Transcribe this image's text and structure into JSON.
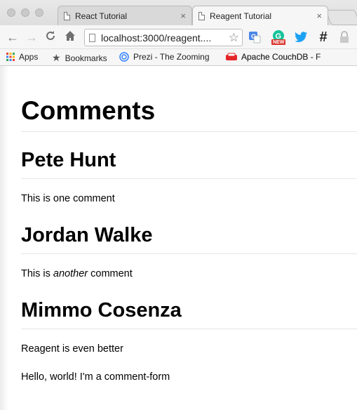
{
  "browser": {
    "tabs": [
      {
        "title": "React Tutorial",
        "active": false
      },
      {
        "title": "Reagent Tutorial",
        "active": true
      }
    ],
    "tab_close_glyph": "×",
    "url": "localhost:3000/reagent....",
    "bookmarks": [
      {
        "label": "Apps",
        "icon": "apps-grid-icon"
      },
      {
        "label": "Bookmarks",
        "icon": "star-icon"
      },
      {
        "label": "Prezi - The Zooming",
        "icon": "prezi-icon"
      },
      {
        "label": "Apache CouchDB - F",
        "icon": "couchdb-icon"
      }
    ],
    "extension_badge": "NEW",
    "extension_hash": "#"
  },
  "page": {
    "title": "Comments",
    "comments": [
      {
        "author": "Pete Hunt",
        "text_before": "This is one comment",
        "emphasis": "",
        "text_after": ""
      },
      {
        "author": "Jordan Walke",
        "text_before": "This is ",
        "emphasis": "another",
        "text_after": " comment"
      },
      {
        "author": "Mimmo Cosenza",
        "text_before": "Reagent is even better",
        "emphasis": "",
        "text_after": ""
      }
    ],
    "form_text": "Hello, world! I'm a comment-form"
  },
  "colors": {
    "twitter_blue": "#1da1f2",
    "grammarly_green": "#15c39a",
    "badge_red": "#d9342b",
    "couchdb_red": "#e42528"
  }
}
